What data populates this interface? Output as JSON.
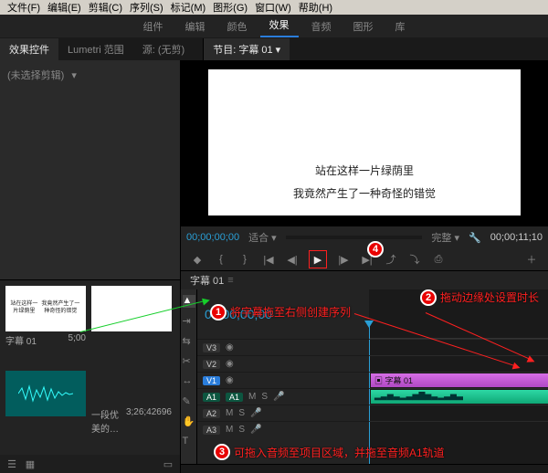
{
  "menu": {
    "file": "文件(F)",
    "edit": "编辑(E)",
    "clip": "剪辑(C)",
    "sequence": "序列(S)",
    "marker": "标记(M)",
    "graphics": "图形(G)",
    "window": "窗口(W)",
    "help": "帮助(H)"
  },
  "workspace_tabs": [
    "组件",
    "编辑",
    "颜色",
    "效果",
    "音频",
    "图形",
    "库"
  ],
  "workspace_active": "效果",
  "left_sub_tabs": {
    "a": "效果控件",
    "b": "Lumetri 范围",
    "c": "源: (无剪)"
  },
  "right_sub_tab": "节目: 字幕 01",
  "effect_panel": {
    "placeholder": "(未选择剪辑)"
  },
  "subtitle1": "站在这样一片绿荫里",
  "subtitle2": "我竟然产生了一种奇怪的错觉",
  "timecode": {
    "cur": "00;00;00;00",
    "dur": "00;00;11;10",
    "fit": "适合",
    "quality": "完整"
  },
  "tl_tab": "字幕 01",
  "tl_timecode": "00;00;00;00",
  "tracks": {
    "v3": "V3",
    "v2": "V2",
    "v1": "V1",
    "a1": "A1",
    "a2": "A2",
    "a3": "A3"
  },
  "clip_v_name": "字幕 01",
  "bins": {
    "sub_name": "字幕 01",
    "sub_dur": "5;00",
    "audio_name": "一段优美的…",
    "audio_dur": "3;26;42696"
  },
  "callouts": {
    "c1": "1",
    "c1t": "将字幕拖至右侧创建序列",
    "c2": "2",
    "c2t": "拖动边缘处设置时长",
    "c3": "3",
    "c3t": "可拖入音频至项目区域，并拖至音频A1轨道",
    "c4": "4"
  }
}
